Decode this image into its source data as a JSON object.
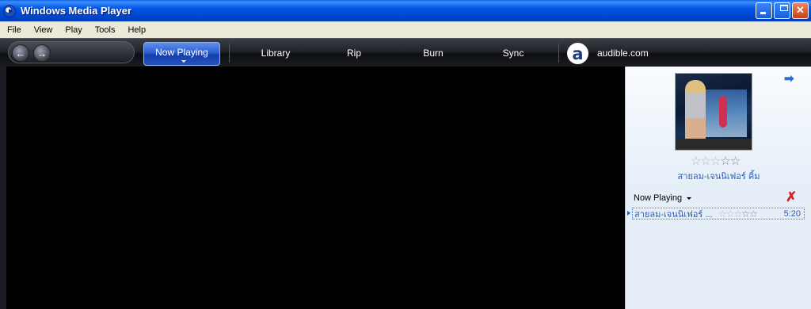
{
  "window": {
    "title": "Windows Media Player"
  },
  "menu": [
    "File",
    "View",
    "Play",
    "Tools",
    "Help"
  ],
  "tabs": {
    "now_playing": "Now Playing",
    "library": "Library",
    "rip": "Rip",
    "burn": "Burn",
    "sync": "Sync",
    "audible": "audible.com"
  },
  "audible_logo_letter": "a",
  "album": {
    "title": "สายลม-เจนนิเฟอร์ คิ้ม",
    "rating_stars": 3,
    "rating_max": 5
  },
  "playlist": {
    "header": "Now Playing",
    "items": [
      {
        "title": "สายลม-เจนนิเฟอร์ ...",
        "rating": 3,
        "duration": "5:20"
      }
    ]
  },
  "icons": {
    "back": "back-arrow-icon",
    "forward": "forward-arrow-icon",
    "next_arrow": "right-arrow-icon",
    "clear": "red-x-icon"
  },
  "colors": {
    "accent": "#2a5fb8",
    "titlebar": "#0054e3"
  }
}
